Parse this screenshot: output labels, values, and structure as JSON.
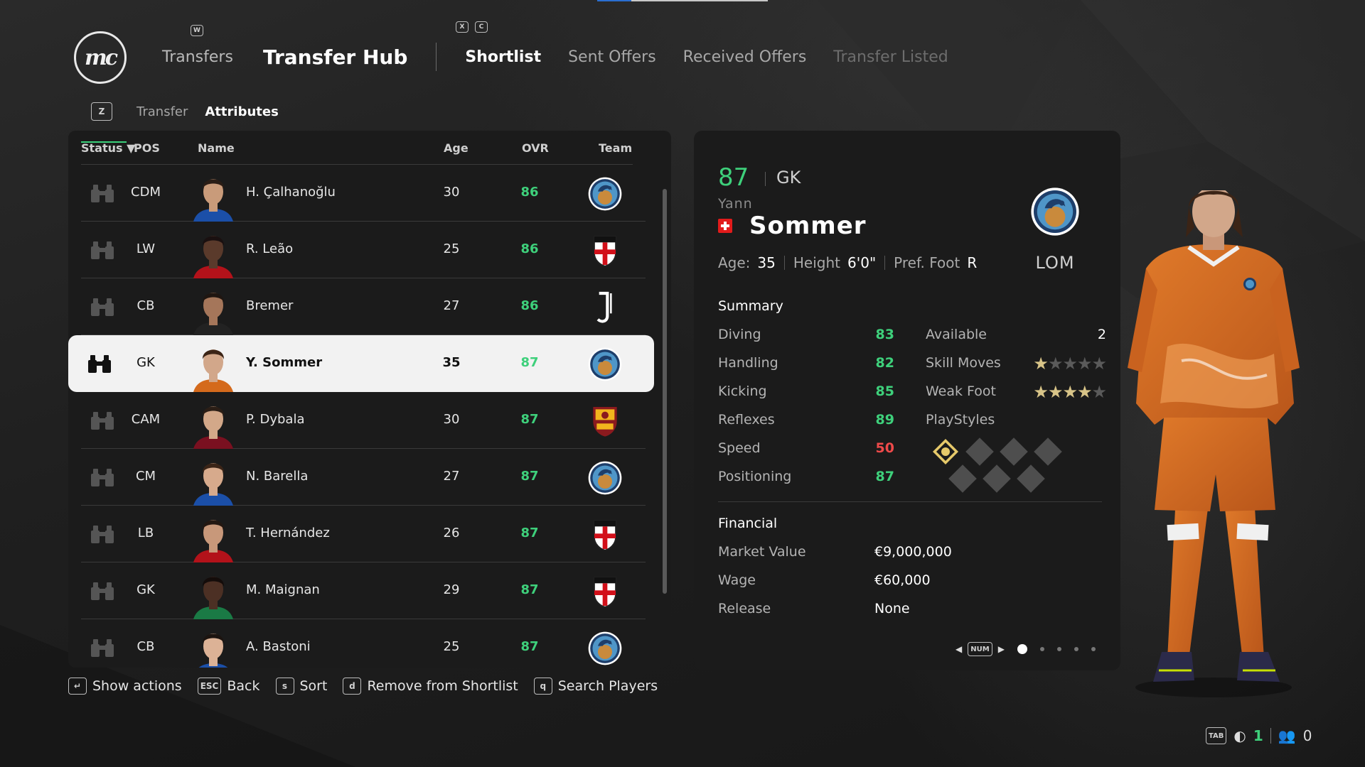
{
  "header": {
    "logo_text": "mc",
    "nav_hint_key": "W",
    "tab_hint_keys": [
      "X",
      "C"
    ],
    "section": "Transfers",
    "title": "Transfer Hub",
    "tabs": [
      {
        "label": "Shortlist",
        "state": "active"
      },
      {
        "label": "Sent Offers",
        "state": "normal"
      },
      {
        "label": "Received Offers",
        "state": "normal"
      },
      {
        "label": "Transfer Listed",
        "state": "disabled"
      }
    ]
  },
  "subnav": {
    "key": "Z",
    "items": [
      {
        "label": "Transfer",
        "active": false
      },
      {
        "label": "Attributes",
        "active": true
      }
    ]
  },
  "table": {
    "columns": {
      "status": "Status",
      "pos": "POS",
      "name": "Name",
      "age": "Age",
      "ovr": "OVR",
      "team": "Team"
    },
    "sort_indicator": "▼",
    "rows": [
      {
        "pos": "CDM",
        "name": "H. Çalhanoğlu",
        "age": "30",
        "ovr": "86",
        "team": "inter-crest",
        "skin": "#c99b7a",
        "hair": "#2a1d16",
        "kit": "#1b4fa8"
      },
      {
        "pos": "LW",
        "name": "R. Leão",
        "age": "25",
        "ovr": "86",
        "team": "milan-crest",
        "skin": "#5a3a2b",
        "hair": "#1a1010",
        "kit": "#b3121a"
      },
      {
        "pos": "CB",
        "name": "Bremer",
        "age": "27",
        "ovr": "86",
        "team": "juventus-crest",
        "skin": "#a5765a",
        "hair": "#1f1611",
        "kit": "#222222"
      },
      {
        "pos": "GK",
        "name": "Y. Sommer",
        "age": "35",
        "ovr": "87",
        "team": "inter-crest",
        "skin": "#d2a78a",
        "hair": "#3b2416",
        "kit": "#d46a1c",
        "selected": true
      },
      {
        "pos": "CAM",
        "name": "P. Dybala",
        "age": "30",
        "ovr": "87",
        "team": "roma-crest",
        "skin": "#d3a889",
        "hair": "#2b1e16",
        "kit": "#7a1020"
      },
      {
        "pos": "CM",
        "name": "N. Barella",
        "age": "27",
        "ovr": "87",
        "team": "inter-crest",
        "skin": "#d7aa8c",
        "hair": "#3a2417",
        "kit": "#1b4fa8"
      },
      {
        "pos": "LB",
        "name": "T. Hernández",
        "age": "26",
        "ovr": "87",
        "team": "milan-crest",
        "skin": "#c8987a",
        "hair": "#241812",
        "kit": "#b3121a"
      },
      {
        "pos": "GK",
        "name": "M. Maignan",
        "age": "29",
        "ovr": "87",
        "team": "milan-crest",
        "skin": "#4c3024",
        "hair": "#140c0a",
        "kit": "#1a7a45"
      },
      {
        "pos": "CB",
        "name": "A. Bastoni",
        "age": "25",
        "ovr": "87",
        "team": "inter-crest",
        "skin": "#dcb296",
        "hair": "#1c1410",
        "kit": "#1b4fa8"
      }
    ]
  },
  "player": {
    "ovr": "87",
    "position": "GK",
    "first_name": "Yann",
    "last_name": "Sommer",
    "nationality_flag": "switzerland-flag",
    "age_label": "Age:",
    "age": "35",
    "height_label": "Height",
    "height": "6'0\"",
    "foot_label": "Pref. Foot",
    "foot": "R",
    "club_abbr": "LOM",
    "summary_title": "Summary",
    "stats": [
      {
        "label": "Diving",
        "value": "83",
        "tone": "g"
      },
      {
        "label": "Handling",
        "value": "82",
        "tone": "g"
      },
      {
        "label": "Kicking",
        "value": "85",
        "tone": "g"
      },
      {
        "label": "Reflexes",
        "value": "89",
        "tone": "g"
      },
      {
        "label": "Speed",
        "value": "50",
        "tone": "r"
      },
      {
        "label": "Positioning",
        "value": "87",
        "tone": "g"
      }
    ],
    "available_label": "Available",
    "available": "2",
    "skill_moves_label": "Skill Moves",
    "skill_moves": 1,
    "weak_foot_label": "Weak Foot",
    "weak_foot": 4,
    "playstyles_label": "PlayStyles",
    "financial_title": "Financial",
    "financial": [
      {
        "label": "Market Value",
        "value": "€9,000,000"
      },
      {
        "label": "Wage",
        "value": "€60,000"
      },
      {
        "label": "Release",
        "value": "None"
      }
    ],
    "pager_key": "NUM",
    "pages": 5,
    "active_page": 1
  },
  "footer": [
    {
      "key": "↵",
      "label": "Show actions"
    },
    {
      "key": "ESC",
      "label": "Back"
    },
    {
      "key": "s",
      "label": "Sort"
    },
    {
      "key": "d",
      "label": "Remove from Shortlist"
    },
    {
      "key": "q",
      "label": "Search Players"
    }
  ],
  "status_bar": {
    "key": "TAB",
    "voice_count": "1",
    "party_count": "0"
  },
  "colors": {
    "accent_green": "#3ed07b",
    "warn_red": "#ef4a4a",
    "star_gold": "#d8c488"
  }
}
